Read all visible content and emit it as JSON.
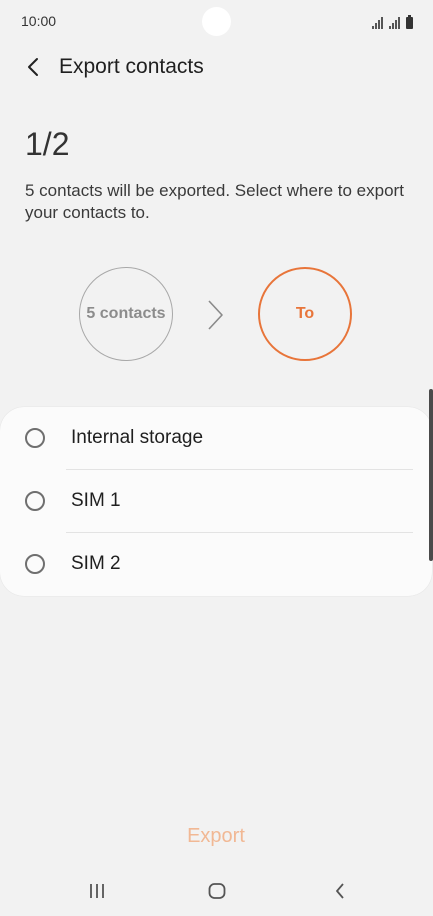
{
  "status_bar": {
    "time": "10:00"
  },
  "app_bar": {
    "title": "Export contacts",
    "back_icon": "chevron-left-icon"
  },
  "step": {
    "counter": "1/2",
    "description": "5 contacts will be exported. Select where to export your contacts to."
  },
  "flow": {
    "source_label": "5 contacts",
    "destination_label": "To",
    "arrow_icon": "chevron-right-icon"
  },
  "options": [
    {
      "label": "Internal storage",
      "selected": false
    },
    {
      "label": "SIM 1",
      "selected": false
    },
    {
      "label": "SIM 2",
      "selected": false
    }
  ],
  "actions": {
    "export_label": "Export",
    "export_enabled": false
  },
  "nav_bar": {
    "recents_icon": "recent-apps-icon",
    "home_icon": "home-icon",
    "back_icon": "back-icon"
  },
  "colors": {
    "accent": "#e8753a",
    "accent_disabled": "#f1b894",
    "background": "#f2f2f2",
    "card": "#fbfbfb"
  }
}
